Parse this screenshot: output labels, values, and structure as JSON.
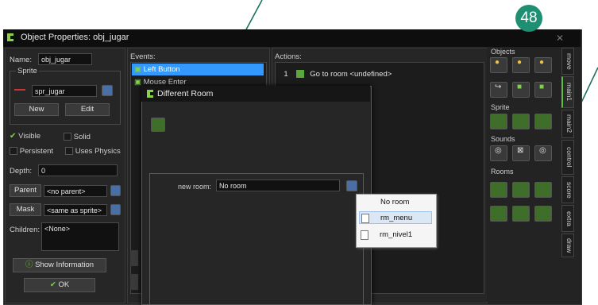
{
  "window": {
    "title": "Object Properties: obj_jugar"
  },
  "badge": {
    "number": "48",
    "color": "#1f8f74"
  },
  "left": {
    "name_label": "Name:",
    "name_value": "obj_jugar",
    "sprite_group": "Sprite",
    "sprite_value": "spr_jugar",
    "new_label": "New",
    "edit_label": "Edit",
    "visible_label": "Visible",
    "solid_label": "Solid",
    "persistent_label": "Persistent",
    "physics_label": "Uses Physics",
    "depth_label": "Depth:",
    "depth_value": "0",
    "parent_btn": "Parent",
    "parent_value": "<no parent>",
    "mask_btn": "Mask",
    "mask_value": "<same as sprite>",
    "children_label": "Children:",
    "children_value": "<None>",
    "show_info": "Show Information",
    "ok": "OK"
  },
  "events": {
    "header": "Events:",
    "items": [
      "Left Button",
      "Mouse Enter"
    ]
  },
  "actions": {
    "header": "Actions:",
    "items": [
      {
        "num": "1",
        "text": "Go to room <undefined>"
      }
    ]
  },
  "dialog": {
    "title": "Different Room",
    "new_room_label": "new room:",
    "new_room_value": "No room"
  },
  "dropdown": {
    "items": [
      "No room",
      "rm_menu",
      "rm_nivel1"
    ]
  },
  "right": {
    "objects_label": "Objects",
    "sprite_label": "Sprite",
    "sounds_label": "Sounds",
    "rooms_label": "Rooms",
    "tabs": [
      "move",
      "main1",
      "main2",
      "control",
      "score",
      "extra",
      "draw"
    ]
  },
  "colors": {
    "selection": "#3399ff",
    "accent_green": "#1f8f74"
  }
}
